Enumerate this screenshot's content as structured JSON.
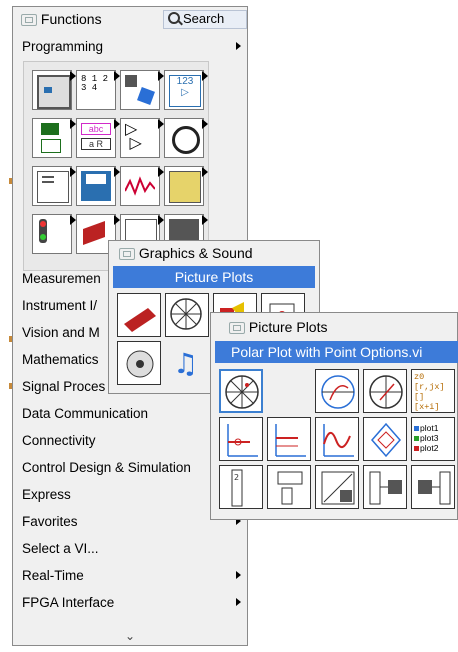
{
  "palette": {
    "title": "Functions",
    "search_label": "Search",
    "open_category": "Programming",
    "categories": [
      "Measurement I/O",
      "Instrument I/O",
      "Vision and Motion",
      "Mathematics",
      "Signal Processing",
      "Data Communication",
      "Connectivity",
      "Control Design & Simulation",
      "Express",
      "Favorites",
      "Select a VI...",
      "Real-Time",
      "FPGA Interface"
    ],
    "visible_categories": [
      "Measuremen",
      "Instrument I/",
      "Vision and M",
      "Mathematics",
      "Signal Proces",
      "Data Communication",
      "Connectivity",
      "Control Design & Simulation",
      "Express",
      "Favorites",
      "Select a VI...",
      "Real-Time",
      "FPGA Interface"
    ]
  },
  "graphics_sound": {
    "title": "Graphics & Sound",
    "highlighted": "Picture Plots"
  },
  "picture_plots": {
    "title": "Picture Plots",
    "highlighted": "Polar Plot with Point Options.vi",
    "legend_labels": [
      "plot1",
      "plot3",
      "plot2"
    ],
    "formula_lines": [
      "z0",
      "[r,jx] []",
      "[x+i]"
    ]
  },
  "colors": {
    "highlight": "#3d7bd9",
    "accent_orange": "#c78a3a"
  }
}
